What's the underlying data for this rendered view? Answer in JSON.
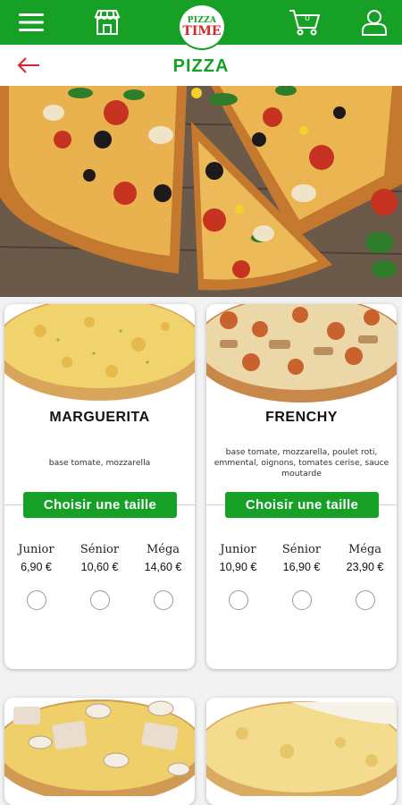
{
  "header": {
    "logo_top": "PIZZA",
    "logo_bottom": "TIME",
    "cart_count": "0",
    "icons": [
      "menu-icon",
      "store-icon",
      "cart-icon",
      "user-icon"
    ],
    "brand_color": "#16a025"
  },
  "subheader": {
    "title": "PIZZA",
    "back_icon": "arrow-left-icon",
    "back_color": "#d8262c"
  },
  "products": [
    {
      "name": "MARGUERITA",
      "description": "base tomate, mozzarella",
      "button_label": "Choisir une taille",
      "sizes": [
        {
          "label": "Junior",
          "price": "6,90 €"
        },
        {
          "label": "Sénior",
          "price": "10,60 €"
        },
        {
          "label": "Méga",
          "price": "14,60 €"
        }
      ]
    },
    {
      "name": "FRENCHY",
      "description": "base tomate, mozzarella, poulet roti, emmental, oignons, tomates cerise, sauce moutarde",
      "button_label": "Choisir une taille",
      "sizes": [
        {
          "label": "Junior",
          "price": "10,90 €"
        },
        {
          "label": "Sénior",
          "price": "16,90 €"
        },
        {
          "label": "Méga",
          "price": "23,90 €"
        }
      ]
    }
  ]
}
